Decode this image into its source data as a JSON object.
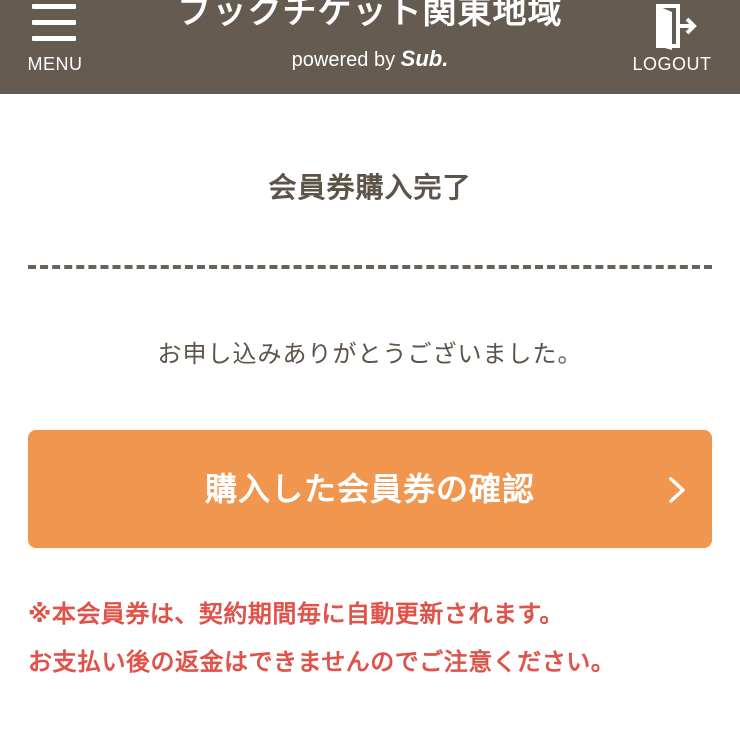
{
  "header": {
    "menu_label": "MENU",
    "title": "ブックチケット関東地域",
    "powered_prefix": "powered by ",
    "powered_brand": "Sub.",
    "logout_label": "LOGOUT",
    "background_color": "#655b51"
  },
  "main": {
    "title": "会員券購入完了",
    "message": "お申し込みありがとうございました。",
    "confirm_button_label": "購入した会員券の確認",
    "confirm_button_color": "#f0964e",
    "notice_lines": [
      "※本会員券は、契約期間毎に自動更新されます。",
      "お支払い後の返金はできませんのでご注意ください。"
    ],
    "notice_color": "#e0534a"
  },
  "icons": {
    "menu": "hamburger-icon",
    "logout": "logout-door-icon",
    "button_arrow": "chevron-right-icon"
  }
}
